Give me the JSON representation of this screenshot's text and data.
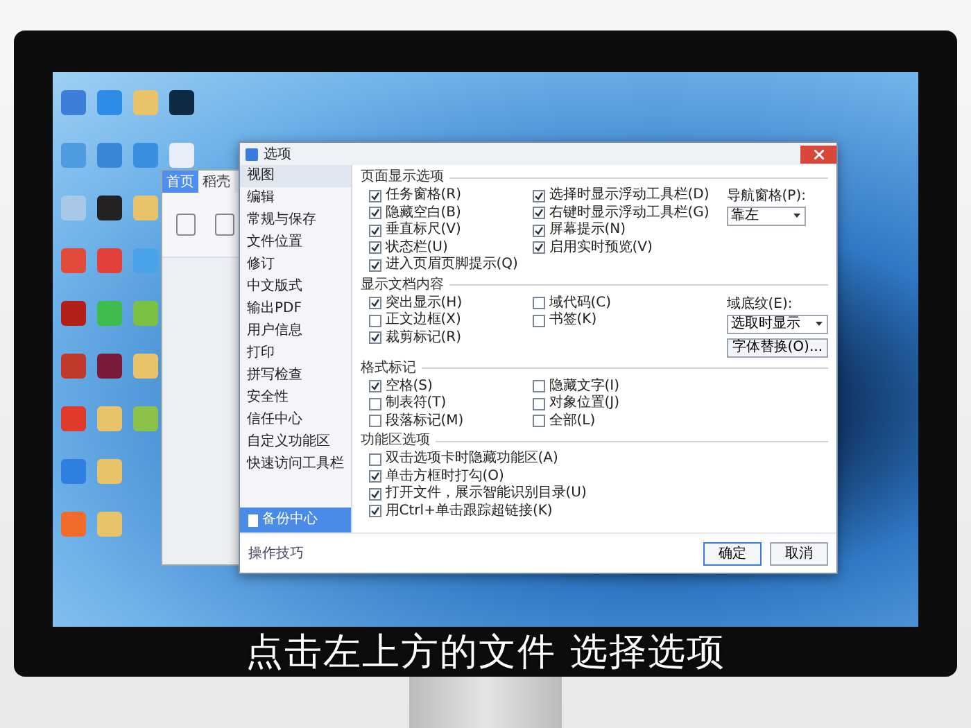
{
  "wps_window": {
    "tabs": [
      {
        "label": "首页",
        "selected": true
      },
      {
        "label": "稻壳",
        "selected": false
      }
    ]
  },
  "dialog": {
    "title": "选项",
    "nav": [
      {
        "label": "视图",
        "selected": true
      },
      {
        "label": "编辑",
        "selected": false
      },
      {
        "label": "常规与保存",
        "selected": false
      },
      {
        "label": "文件位置",
        "selected": false
      },
      {
        "label": "修订",
        "selected": false
      },
      {
        "label": "中文版式",
        "selected": false
      },
      {
        "label": "输出PDF",
        "selected": false
      },
      {
        "label": "用户信息",
        "selected": false
      },
      {
        "label": "打印",
        "selected": false
      },
      {
        "label": "拼写检查",
        "selected": false
      },
      {
        "label": "安全性",
        "selected": false
      },
      {
        "label": "信任中心",
        "selected": false
      },
      {
        "label": "自定义功能区",
        "selected": false
      },
      {
        "label": "快速访问工具栏",
        "selected": false
      }
    ],
    "sections": [
      {
        "title": "页面显示选项",
        "columns": [
          [
            {
              "label": "任务窗格(R)",
              "checked": true
            },
            {
              "label": "隐藏空白(B)",
              "checked": true
            },
            {
              "label": "垂直标尺(V)",
              "checked": true
            },
            {
              "label": "状态栏(U)",
              "checked": true
            },
            {
              "label": "进入页眉页脚提示(Q)",
              "checked": true
            }
          ],
          [
            {
              "label": "选择时显示浮动工具栏(D)",
              "checked": true
            },
            {
              "label": "右键时显示浮动工具栏(G)",
              "checked": true
            },
            {
              "label": "屏幕提示(N)",
              "checked": true
            },
            {
              "label": "启用实时预览(V)",
              "checked": true
            }
          ]
        ],
        "side": {
          "label": "导航窗格(P):",
          "dropdown": "靠左"
        }
      },
      {
        "title": "显示文档内容",
        "columns": [
          [
            {
              "label": "突出显示(H)",
              "checked": true
            },
            {
              "label": "正文边框(X)",
              "checked": false
            },
            {
              "label": "裁剪标记(R)",
              "checked": true
            }
          ],
          [
            {
              "label": "域代码(C)",
              "checked": false
            },
            {
              "label": "书签(K)",
              "checked": false
            }
          ]
        ],
        "side": {
          "label": "域底纹(E):",
          "dropdown": "选取时显示",
          "button": "字体替换(O)..."
        }
      },
      {
        "title": "格式标记",
        "columns": [
          [
            {
              "label": "空格(S)",
              "checked": true
            },
            {
              "label": "制表符(T)",
              "checked": false
            },
            {
              "label": "段落标记(M)",
              "checked": false
            }
          ],
          [
            {
              "label": "隐藏文字(I)",
              "checked": false
            },
            {
              "label": "对象位置(J)",
              "checked": false
            },
            {
              "label": "全部(L)",
              "checked": false
            }
          ]
        ]
      },
      {
        "title": "功能区选项",
        "columns": [
          [
            {
              "label": "双击选项卡时隐藏功能区(A)",
              "checked": false
            },
            {
              "label": "单击方框时打勾(O)",
              "checked": true
            },
            {
              "label": "打开文件，展示智能识别目录(U)",
              "checked": true
            },
            {
              "label": "用Ctrl+单击跟踪超链接(K)",
              "checked": true
            }
          ]
        ]
      }
    ],
    "backup_center": "备份中心",
    "tips_link": "操作技巧",
    "buttons": [
      "确定",
      "取消"
    ]
  },
  "subtitle": "点击左上方的文件 选择选项"
}
